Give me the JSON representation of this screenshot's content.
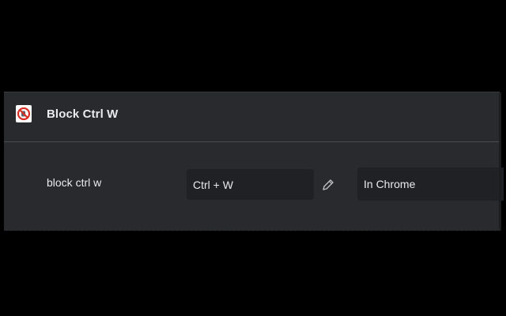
{
  "extension": {
    "name": "Block Ctrl W",
    "icon": "no-symbol-icon"
  },
  "shortcut": {
    "label": "block ctrl w",
    "value": "Ctrl + W",
    "edit_icon": "pencil-icon",
    "scope": "In Chrome"
  },
  "colors": {
    "background": "#000000",
    "panel": "#292a2d",
    "field": "#202124",
    "text": "#e8eaed",
    "divider": "#4a4b4f",
    "icon_red": "#d93025"
  }
}
